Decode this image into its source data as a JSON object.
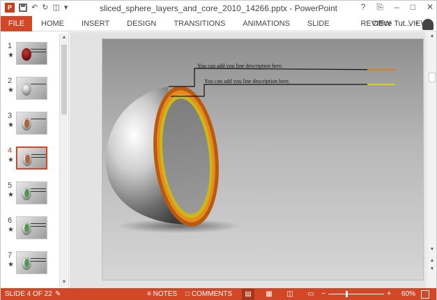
{
  "titlebar": {
    "title": "sliced_sphere_layers_and_core_2010_14266.pptx - PowerPoint",
    "app_logo": "P",
    "help": "?",
    "restore": "⎘",
    "minimize": "–",
    "maximize": "□",
    "close": "✕"
  },
  "ribbon": {
    "file_label": "FILE",
    "tabs": [
      "HOME",
      "INSERT",
      "DESIGN",
      "TRANSITIONS",
      "ANIMATIONS",
      "SLIDE SHOW",
      "REVIEW",
      "VIEW"
    ],
    "account_name": "Office Tut..."
  },
  "thumbnails": {
    "items": [
      {
        "num": "1",
        "star": "★"
      },
      {
        "num": "2",
        "star": "★"
      },
      {
        "num": "3",
        "star": "★"
      },
      {
        "num": "4",
        "star": "★"
      },
      {
        "num": "5",
        "star": "★"
      },
      {
        "num": "6",
        "star": "★"
      },
      {
        "num": "7",
        "star": "★"
      }
    ],
    "active_index": 3
  },
  "slide": {
    "description_1": "You can add you line description here.",
    "description_2": "You can add you line description here.",
    "colors": {
      "outer_ring": "#d06a12",
      "inner_ring": "#d4c21a",
      "sphere": "#9a9a9a"
    }
  },
  "statusbar": {
    "slide_count": "SLIDE 4 OF 22",
    "notes_label": "NOTES",
    "comments_label": "COMMENTS",
    "zoom_minus": "−",
    "zoom_plus": "+",
    "zoom_level": "60%",
    "zoom_fraction": 0.6
  }
}
